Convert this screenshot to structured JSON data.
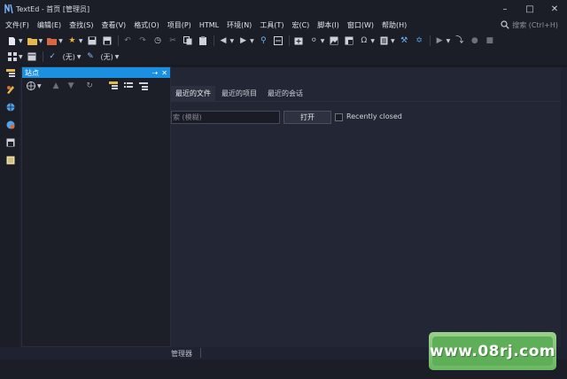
{
  "window": {
    "title": "TextEd - 首页 [管理员]"
  },
  "menu": [
    "文件(F)",
    "编辑(E)",
    "查找(S)",
    "查看(V)",
    "格式(O)",
    "项目(P)",
    "HTML",
    "环境(N)",
    "工具(T)",
    "宏(C)",
    "脚本(I)",
    "窗口(W)",
    "帮助(H)"
  ],
  "search": {
    "placeholder": "搜索 (Ctrl+H)"
  },
  "toolbar2": {
    "combo1": "(无)",
    "combo2": "(无)"
  },
  "site_panel": {
    "title": "站点"
  },
  "home": {
    "tabs": [
      "最近的文件",
      "最近的项目",
      "最近的会话"
    ],
    "active_tab": 0,
    "search_placeholder": "索 (模糊)",
    "open_button": "打开",
    "recently_closed": "Recently closed"
  },
  "bottom": {
    "tab": "管理器"
  },
  "watermark": "www.08rj.com",
  "colors": {
    "accent": "#1b8fe0",
    "background": "#232634",
    "chrome": "#1b1d27"
  }
}
